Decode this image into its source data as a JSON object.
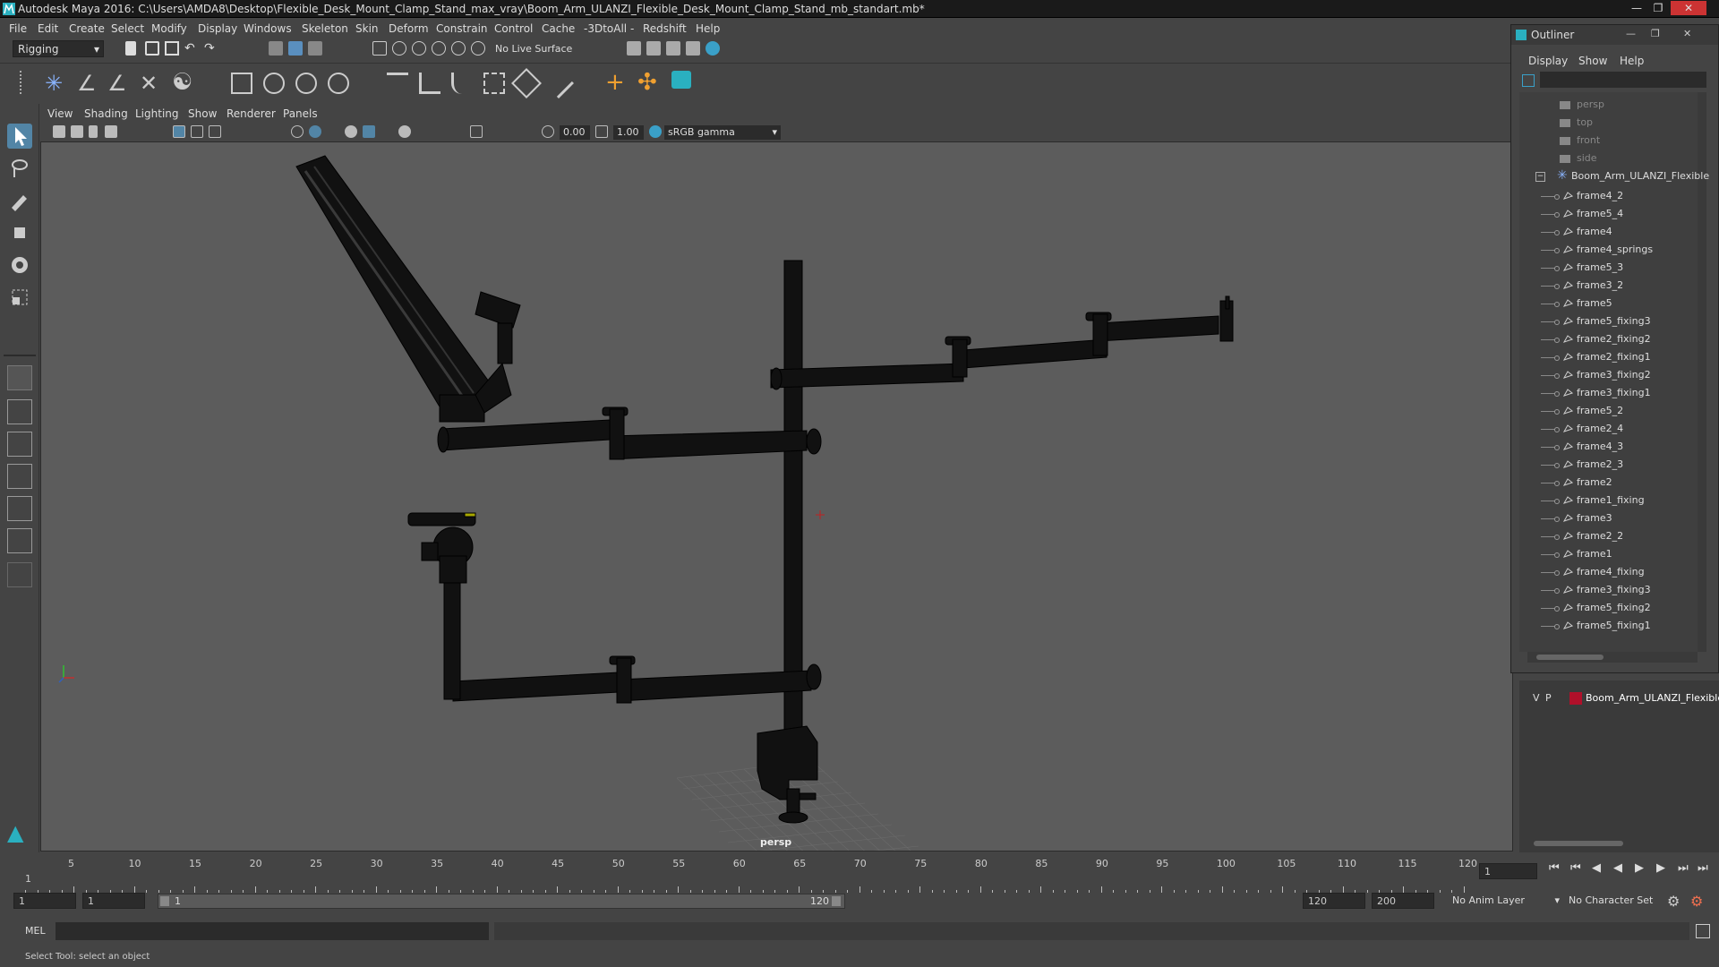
{
  "window": {
    "title": "Autodesk Maya 2016: C:\\Users\\AMDA8\\Desktop\\Flexible_Desk_Mount_Clamp_Stand_max_vray\\Boom_Arm_ULANZI_Flexible_Desk_Mount_Clamp_Stand_mb_standart.mb*"
  },
  "menubar": {
    "items": [
      "File",
      "Edit",
      "Create",
      "Select",
      "Modify",
      "Display",
      "Windows",
      "Skeleton",
      "Skin",
      "Deform",
      "Constrain",
      "Control",
      "Cache",
      "-3DtoAll -",
      "Redshift",
      "Help"
    ]
  },
  "statusline": {
    "mode": "Rigging",
    "live_surface": "No Live Surface"
  },
  "viewport": {
    "menu": [
      "View",
      "Shading",
      "Lighting",
      "Show",
      "Renderer",
      "Panels"
    ],
    "exposure": "0.00",
    "gamma": "1.00",
    "colorspace": "sRGB gamma",
    "camera_label": "persp"
  },
  "outliner": {
    "title": "Outliner",
    "menu": [
      "Display",
      "Show",
      "Help"
    ],
    "cameras": [
      "persp",
      "top",
      "front",
      "side"
    ],
    "root": "Boom_Arm_ULANZI_Flexible",
    "children": [
      "frame4_2",
      "frame5_4",
      "frame4",
      "frame4_springs",
      "frame5_3",
      "frame3_2",
      "frame5",
      "frame5_fixing3",
      "frame2_fixing2",
      "frame2_fixing1",
      "frame3_fixing2",
      "frame3_fixing1",
      "frame5_2",
      "frame2_4",
      "frame4_3",
      "frame2_3",
      "frame2",
      "frame1_fixing",
      "frame3",
      "frame2_2",
      "frame1",
      "frame4_fixing",
      "frame3_fixing3",
      "frame5_fixing2",
      "frame5_fixing1"
    ]
  },
  "layer": {
    "v": "V",
    "p": "P",
    "name": "Boom_Arm_ULANZI_Flexible",
    "color": "#b0102a"
  },
  "timeline": {
    "ticks": [
      "5",
      "10",
      "15",
      "20",
      "25",
      "30",
      "35",
      "40",
      "45",
      "50",
      "55",
      "60",
      "65",
      "70",
      "75",
      "80",
      "85",
      "90",
      "95",
      "100",
      "105",
      "110",
      "115",
      "120"
    ],
    "start_tick": "1",
    "current_frame": "1"
  },
  "range": {
    "start": "1",
    "playback_start": "1",
    "range_start_label": "1",
    "range_end_label": "120",
    "playback_end": "120",
    "end": "200",
    "anim_layer": "No Anim Layer",
    "char_set": "No Character Set"
  },
  "cmd": {
    "label": "MEL"
  },
  "help": {
    "text": "Select Tool: select an object"
  }
}
